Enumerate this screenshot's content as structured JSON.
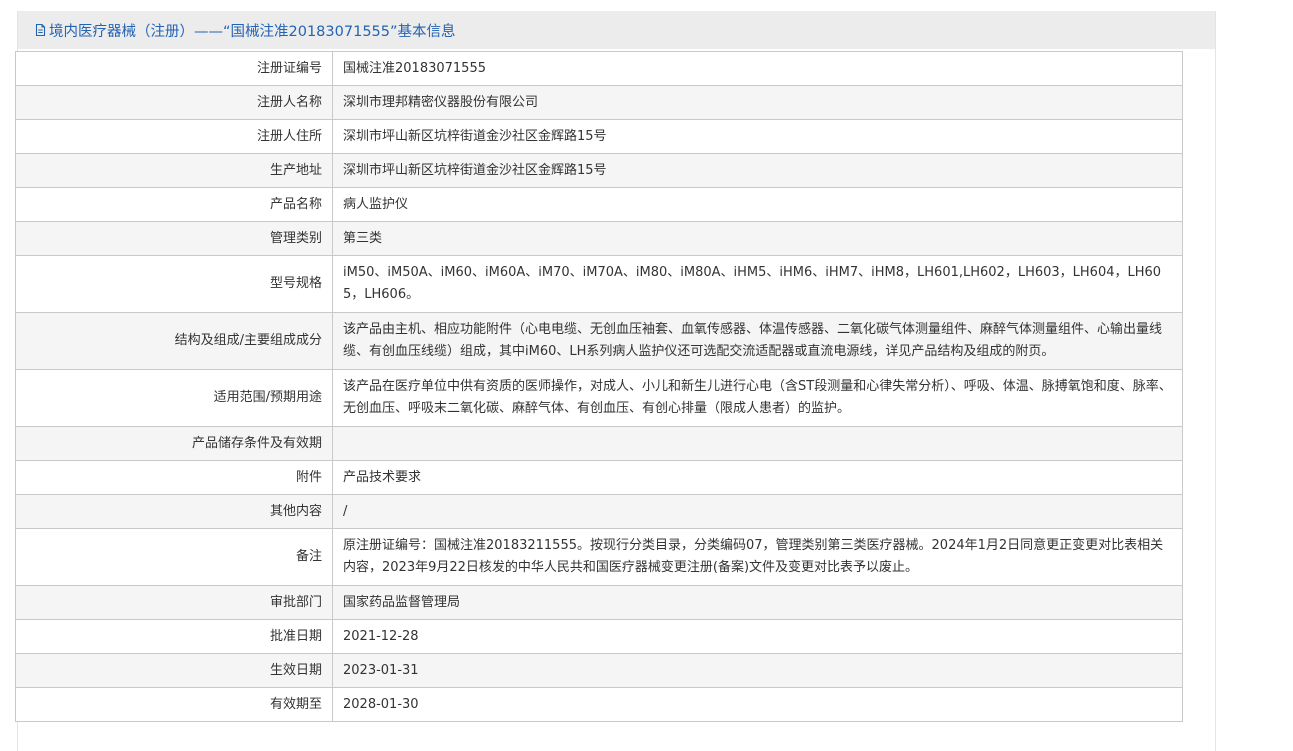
{
  "header": {
    "icon": "document-icon",
    "title": "境内医疗器械（注册）——“国械注准20183071555”基本信息"
  },
  "rows": [
    {
      "label": "注册证编号",
      "value": "国械注准20183071555"
    },
    {
      "label": "注册人名称",
      "value": "深圳市理邦精密仪器股份有限公司"
    },
    {
      "label": "注册人住所",
      "value": "深圳市坪山新区坑梓街道金沙社区金辉路15号"
    },
    {
      "label": "生产地址",
      "value": "深圳市坪山新区坑梓街道金沙社区金辉路15号"
    },
    {
      "label": "产品名称",
      "value": "病人监护仪"
    },
    {
      "label": "管理类别",
      "value": "第三类"
    },
    {
      "label": "型号规格",
      "value": "iM50、iM50A、iM60、iM60A、iM70、iM70A、iM80、iM80A、iHM5、iHM6、iHM7、iHM8，LH601,LH602，LH603，LH604，LH605，LH606。"
    },
    {
      "label": "结构及组成/主要组成成分",
      "value": "该产品由主机、相应功能附件（心电电缆、无创血压袖套、血氧传感器、体温传感器、二氧化碳气体测量组件、麻醉气体测量组件、心输出量线缆、有创血压线缆）组成，其中iM60、LH系列病人监护仪还可选配交流适配器或直流电源线，详见产品结构及组成的附页。"
    },
    {
      "label": "适用范围/预期用途",
      "value": "该产品在医疗单位中供有资质的医师操作，对成人、小儿和新生儿进行心电（含ST段测量和心律失常分析）、呼吸、体温、脉搏氧饱和度、脉率、无创血压、呼吸末二氧化碳、麻醉气体、有创血压、有创心排量（限成人患者）的监护。"
    },
    {
      "label": "产品储存条件及有效期",
      "value": ""
    },
    {
      "label": "附件",
      "value": "产品技术要求"
    },
    {
      "label": "其他内容",
      "value": "/"
    },
    {
      "label": "备注",
      "value": "原注册证编号：国械注准20183211555。按现行分类目录，分类编码07，管理类别第三类医疗器械。2024年1月2日同意更正变更对比表相关内容，2023年9月22日核发的中华人民共和国医疗器械变更注册(备案)文件及变更对比表予以废止。"
    },
    {
      "label": "审批部门",
      "value": "国家药品监督管理局"
    },
    {
      "label": "批准日期",
      "value": "2021-12-28"
    },
    {
      "label": "生效日期",
      "value": "2023-01-31"
    },
    {
      "label": "有效期至",
      "value": "2028-01-30"
    }
  ]
}
